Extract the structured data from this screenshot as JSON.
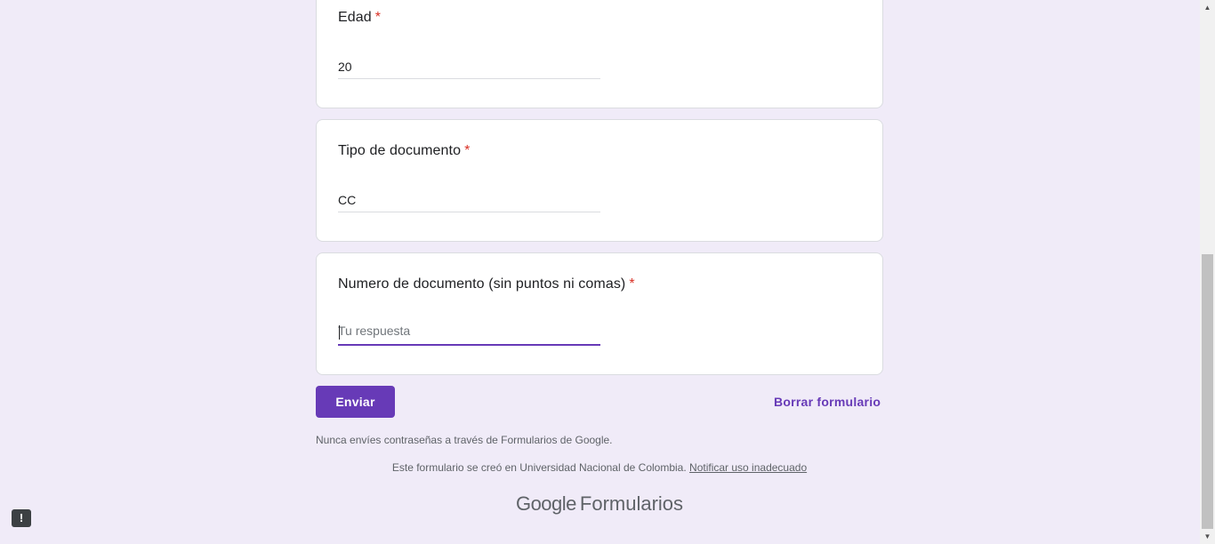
{
  "questions": [
    {
      "title": "Edad",
      "required_mark": "*",
      "value": "20"
    },
    {
      "title": "Tipo de documento",
      "required_mark": "*",
      "value": "CC"
    },
    {
      "title": "Numero de documento (sin puntos ni comas)",
      "required_mark": "*",
      "placeholder": "Tu respuesta",
      "value": ""
    }
  ],
  "actions": {
    "submit_label": "Enviar",
    "clear_label": "Borrar formulario"
  },
  "footer": {
    "warning": "Nunca envíes contraseñas a través de Formularios de Google.",
    "created_by": "Este formulario se creó en Universidad Nacional de Colombia.",
    "report_link": "Notificar uso inadecuado",
    "brand_google": "Google",
    "brand_product": "Formularios"
  },
  "icons": {
    "report": "report-problem-icon",
    "scroll_up": "arrow-up-icon",
    "scroll_down": "arrow-down-icon"
  },
  "colors": {
    "accent": "#673ab7",
    "background": "#f0ebf8",
    "required": "#d93025"
  }
}
